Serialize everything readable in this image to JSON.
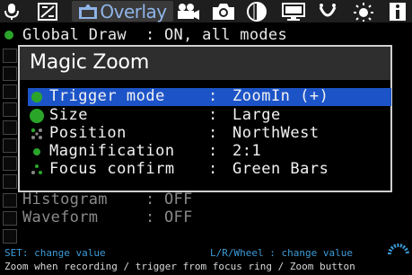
{
  "tabs": [
    {
      "name": "audio-icon"
    },
    {
      "name": "expo-icon"
    },
    {
      "name": "overlay-icon",
      "label": "Overlay"
    },
    {
      "name": "movie-icon"
    },
    {
      "name": "shoot-icon"
    },
    {
      "name": "focus-icon"
    },
    {
      "name": "display-icon"
    },
    {
      "name": "prefs-icon"
    },
    {
      "name": "debug-icon"
    },
    {
      "name": "info-icon"
    }
  ],
  "background_menu": {
    "global_draw": "Global Draw  : ON, all modes",
    "histogram": "Histogram    : OFF",
    "waveform": "Waveform     : OFF"
  },
  "dialog": {
    "title": "Magic Zoom",
    "items": [
      {
        "label": "Trigger mode",
        "value": "ZoomIn (+)",
        "selected": true,
        "icon": "green-dot-icon"
      },
      {
        "label": "Size",
        "value": "Large",
        "selected": false,
        "icon": "green-large-dot-icon"
      },
      {
        "label": "Position",
        "value": "NorthWest",
        "selected": false,
        "icon": "position-dots-icon"
      },
      {
        "label": "Magnification",
        "value": "2:1",
        "selected": false,
        "icon": "green-small-dot-icon"
      },
      {
        "label": "Focus confirm",
        "value": "Green Bars",
        "selected": false,
        "icon": "focus-bars-icon"
      }
    ],
    "separator": ":"
  },
  "help": {
    "set_hint": "SET: change value",
    "wheel_hint": "L/R/Wheel : change value",
    "description": "Zoom when recording / trigger from focus ring / Zoom button"
  },
  "colors": {
    "selection": "#1c54c8",
    "overlay_tab_text": "#8fb4e8",
    "hint_blue": "#3b9bd8",
    "status_green": "#2aa52a"
  }
}
